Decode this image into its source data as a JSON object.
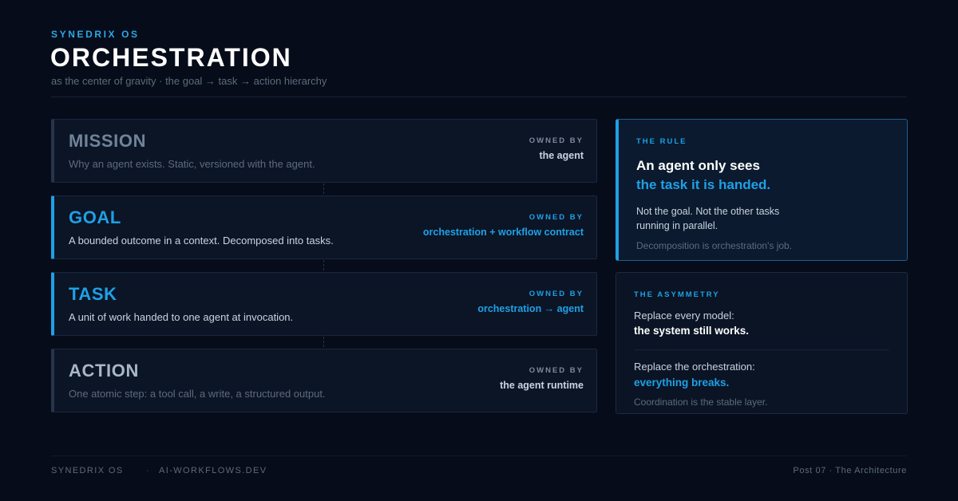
{
  "header": {
    "brand": "SYNEDRIX OS",
    "title": "ORCHESTRATION",
    "subtitle": "as the center of gravity · the goal → task → action hierarchy"
  },
  "colors": {
    "background": "#060c19",
    "accent": "#1fa0e6",
    "muted": "#5d6b7c"
  },
  "layers": [
    {
      "name": "MISSION",
      "description": "Why an agent exists. Static, versioned with the agent.",
      "owned_label": "OWNED BY",
      "owner": "the agent",
      "active": false
    },
    {
      "name": "GOAL",
      "description": "A bounded outcome in a context. Decomposed into tasks.",
      "owned_label": "OWNED BY",
      "owner": "orchestration + workflow contract",
      "active": true
    },
    {
      "name": "TASK",
      "description": "A unit of work handed to one agent at invocation.",
      "owned_label": "OWNED BY",
      "owner": "orchestration → agent",
      "active": true
    },
    {
      "name": "ACTION",
      "description": "One atomic step: a tool call, a write, a structured output.",
      "owned_label": "OWNED BY",
      "owner": "the agent runtime",
      "active": false
    }
  ],
  "rule_card": {
    "label": "THE RULE",
    "headline_1": "An agent only sees",
    "headline_2": "the task it is handed.",
    "body_1": "Not the goal. Not the other tasks",
    "body_2": "running in parallel.",
    "footnote": "Decomposition is orchestration's job."
  },
  "asymmetry_card": {
    "label": "THE ASYMMETRY",
    "line_1": "Replace every model:",
    "line_2": "the system still works.",
    "line_3": "Replace the orchestration:",
    "line_4": "everything breaks.",
    "footnote": "Coordination is the stable layer."
  },
  "footer": {
    "left": "SYNEDRIX OS",
    "separator": "·",
    "middle": "AI-WORKFLOWS.DEV",
    "right": "Post 07 · The Architecture"
  }
}
